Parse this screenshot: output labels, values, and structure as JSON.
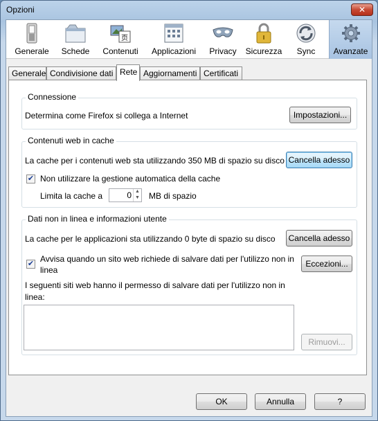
{
  "window": {
    "title": "Opzioni",
    "close_glyph": "✕"
  },
  "panes": [
    {
      "label": "Generale",
      "icon": "switch-icon"
    },
    {
      "label": "Schede",
      "icon": "tabs-icon"
    },
    {
      "label": "Contenuti",
      "icon": "content-icon"
    },
    {
      "label": "Applicazioni",
      "icon": "applications-icon"
    },
    {
      "label": "Privacy",
      "icon": "mask-icon"
    },
    {
      "label": "Sicurezza",
      "icon": "padlock-icon"
    },
    {
      "label": "Sync",
      "icon": "sync-icon"
    },
    {
      "label": "Avanzate",
      "icon": "gear-icon",
      "selected": true
    }
  ],
  "tabs": [
    {
      "label": "Generale"
    },
    {
      "label": "Condivisione dati"
    },
    {
      "label": "Rete",
      "active": true
    },
    {
      "label": "Aggiornamenti"
    },
    {
      "label": "Certificati"
    }
  ],
  "connection": {
    "title": "Connessione",
    "description": "Determina come Firefox si collega a Internet",
    "settings_button": "Impostazioni..."
  },
  "cache": {
    "title": "Contenuti web in cache",
    "description": "La cache per i contenuti web sta utilizzando 350 MB di spazio su disco",
    "clear_button": "Cancella adesso",
    "override_checkbox_label": "Non utilizzare la gestione automatica della cache",
    "override_checked": true,
    "limit_label": "Limita la cache a",
    "limit_value": "0",
    "limit_unit": "MB di spazio"
  },
  "offline": {
    "title": "Dati non in linea e informazioni utente",
    "description": "La cache per le applicazioni sta utilizzando 0 byte di spazio su disco",
    "clear_button": "Cancella adesso",
    "notify_label_line1": "Avvisa quando un sito web richiede di salvare dati per l'utilizzo non in",
    "notify_label_line2": "linea",
    "notify_checked": true,
    "exceptions_button": "Eccezioni...",
    "allowed_sites_line1": "I seguenti siti web hanno il permesso di salvare dati per l'utilizzo non in",
    "allowed_sites_line2": "linea:",
    "remove_button": "Rimuovi..."
  },
  "footer": {
    "ok": "OK",
    "cancel": "Annulla",
    "help": "?"
  },
  "colors": {
    "accent": "#3c7fb1",
    "selected_pane": "#a8c3e2"
  }
}
